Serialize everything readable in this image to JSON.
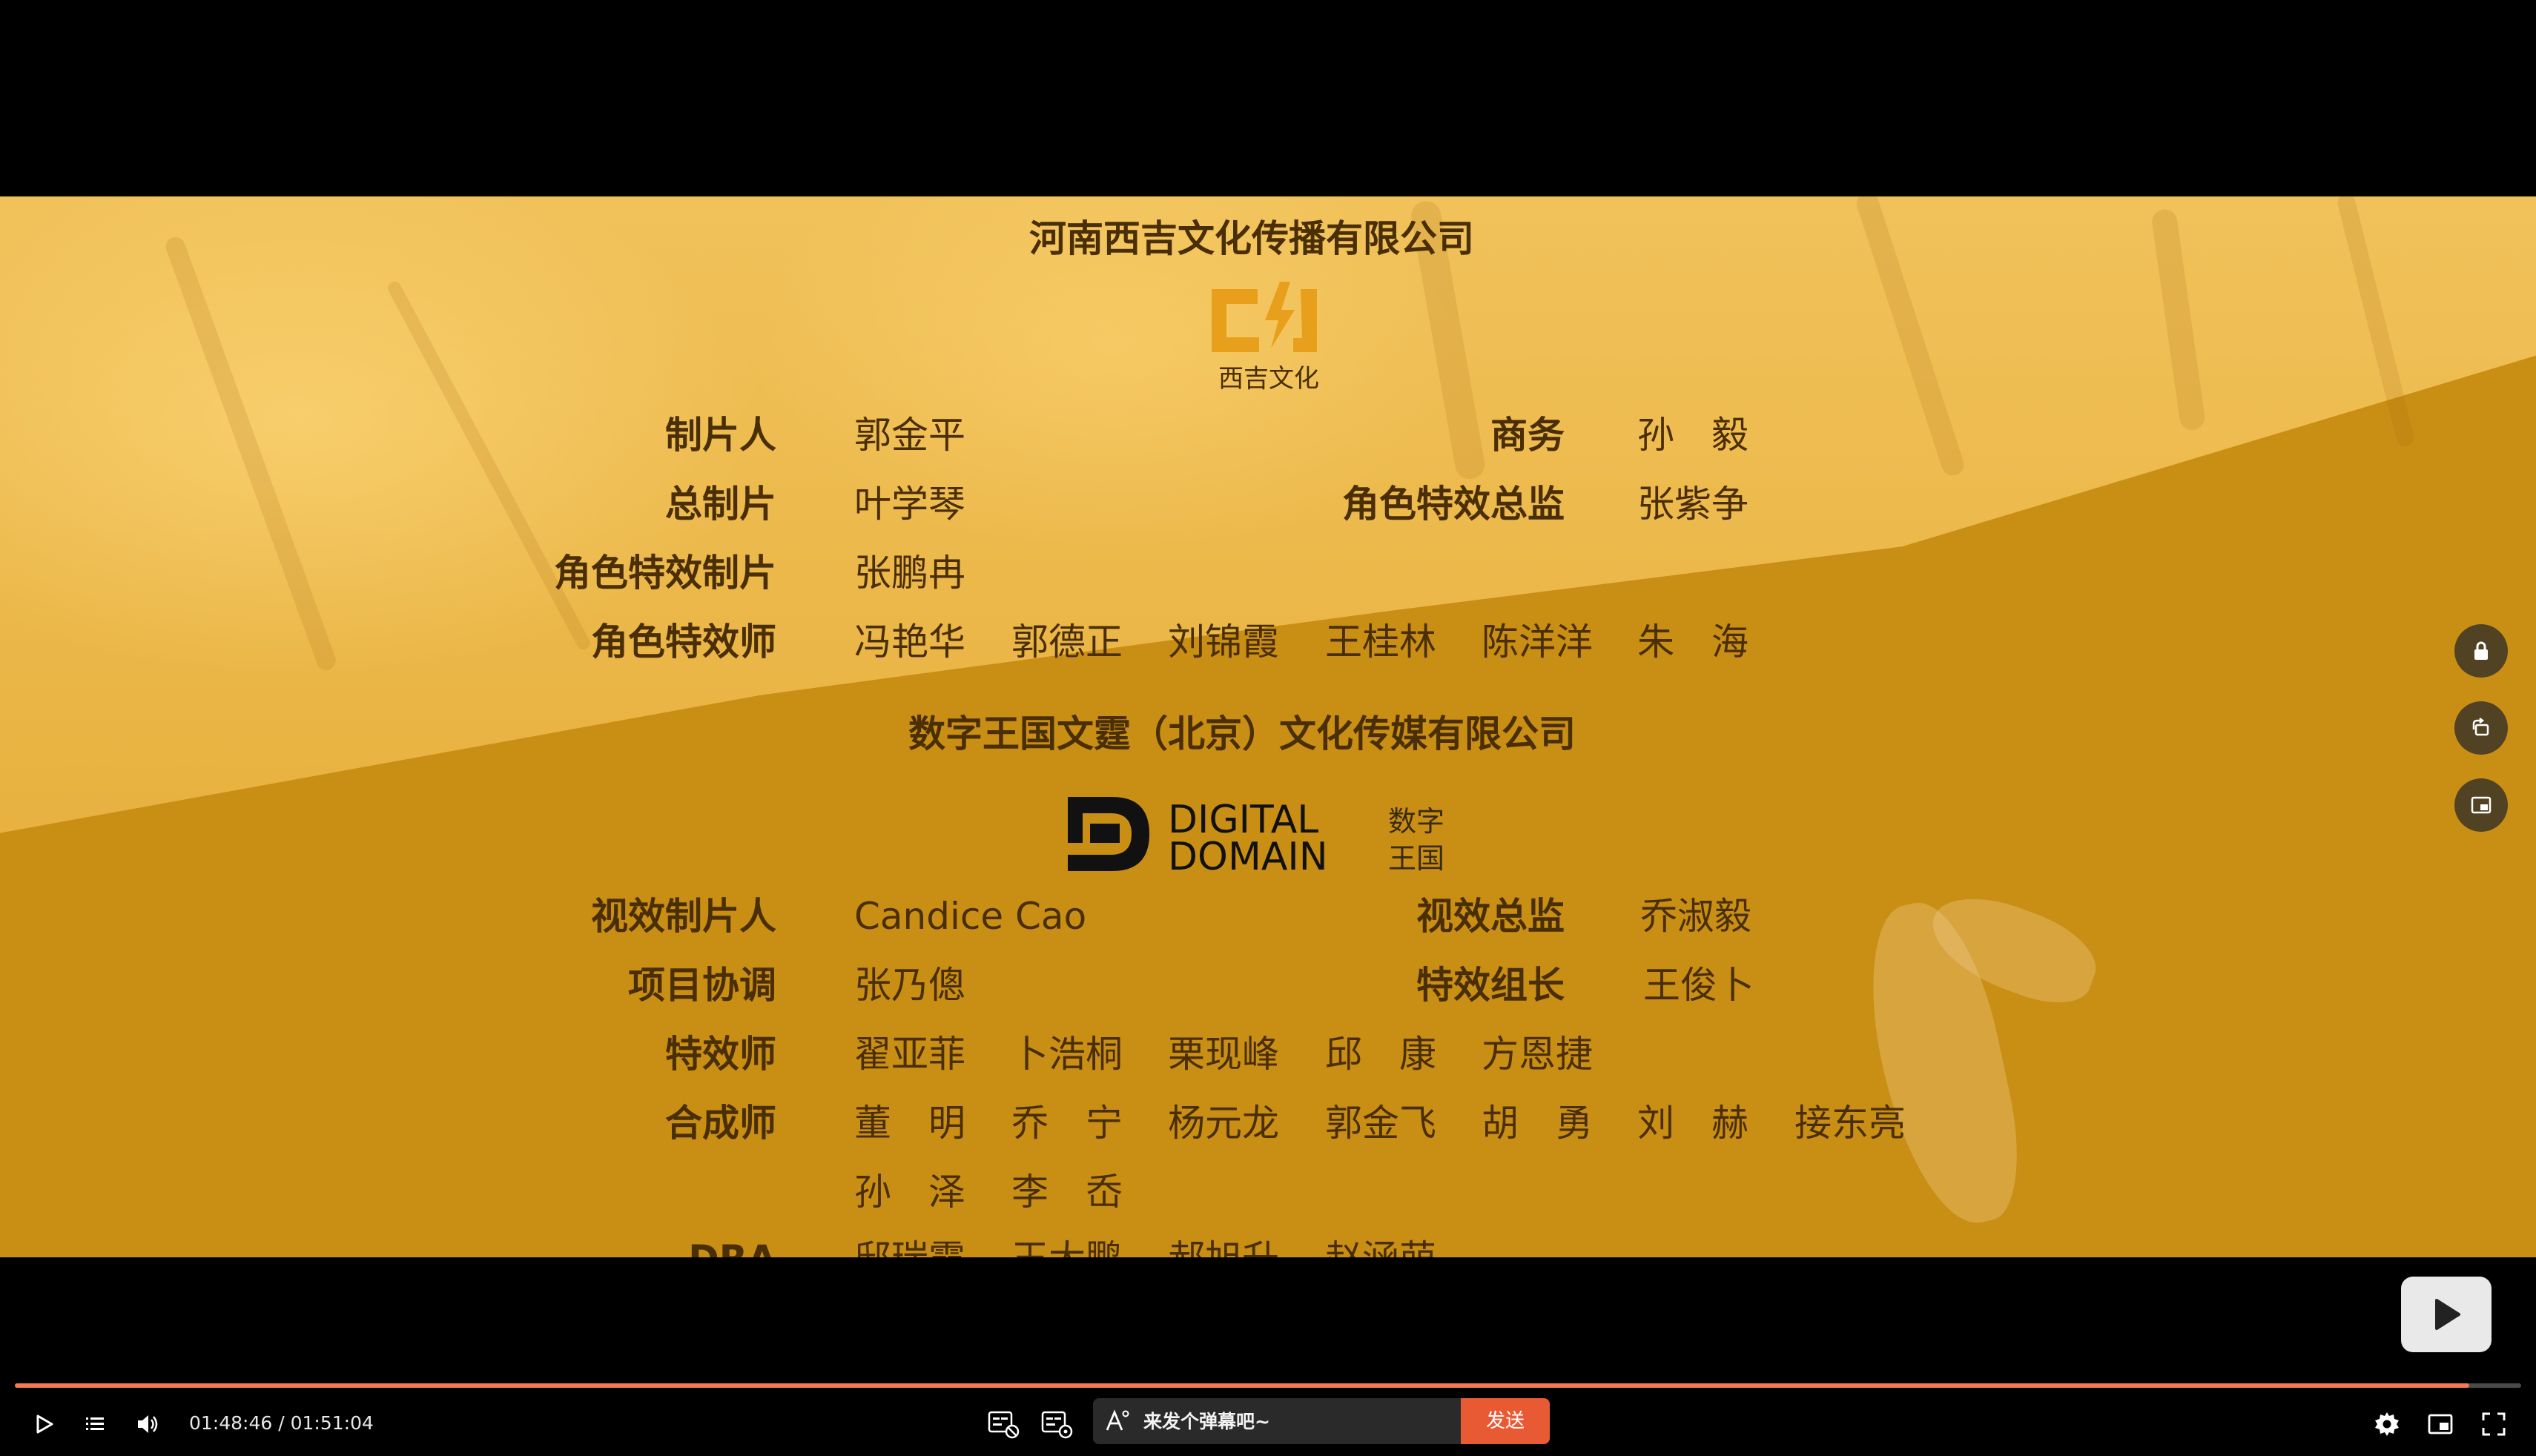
{
  "credits": {
    "company1": "河南西吉文化传播有限公司",
    "company1_logo_text": "西吉文化",
    "rows1": [
      {
        "role": "制片人",
        "names": [
          "郭金平"
        ],
        "role2": "商务",
        "names2": [
          "孙　毅"
        ]
      },
      {
        "role": "总制片",
        "names": [
          "叶学琴"
        ],
        "role2": "角色特效总监",
        "names2": [
          "张紫争"
        ]
      },
      {
        "role": "角色特效制片",
        "names": [
          "张鹏冉"
        ]
      },
      {
        "role": "角色特效师",
        "names": [
          "冯艳华",
          "郭德正",
          "刘锦霞",
          "王桂林",
          "陈洋洋",
          "朱　海"
        ]
      }
    ],
    "company2": "数字王国文霆（北京）文化传媒有限公司",
    "company2_logo": {
      "line1": "DIGITAL",
      "line2": "DOMAIN",
      "cn1": "数字",
      "cn2": "王国"
    },
    "rows2": [
      {
        "role": "视效制片人",
        "names": [
          "Candice Cao"
        ],
        "role2": "视效总监",
        "names2": [
          "乔淑毅"
        ]
      },
      {
        "role": "项目协调",
        "names": [
          "张乃傯"
        ],
        "role2": "特效组长",
        "names2": [
          "王俊卜"
        ]
      },
      {
        "role": "特效师",
        "names": [
          "翟亚菲",
          "卜浩桐",
          "栗现峰",
          "邱　康",
          "方恩捷"
        ]
      },
      {
        "role": "合成师",
        "names": [
          "董　明",
          "乔　宁",
          "杨元龙",
          "郭金飞",
          "胡　勇",
          "刘　赫",
          "接东亮"
        ]
      },
      {
        "role": "",
        "names": [
          "孙　泽",
          "李　岙"
        ]
      },
      {
        "role": "DRA",
        "names": [
          "邸瑞霞",
          "王大鹏",
          "郝旭升",
          "赵涵萌"
        ]
      }
    ]
  },
  "player": {
    "time_display": "01:48:46 / 01:51:04",
    "progress_fraction": 0.9793,
    "danmaku_placeholder": "来发个弹幕吧~",
    "send_label": "发送",
    "accent_color": "#f57a4f",
    "send_color": "#e75a34"
  },
  "icons": {
    "side": [
      "lock-icon",
      "rotate-icon",
      "picture-in-picture-icon"
    ],
    "controls_left": [
      "play-icon",
      "playlist-icon",
      "volume-icon"
    ],
    "controls_mid": [
      "danmaku-toggle-icon",
      "danmaku-settings-icon",
      "danmaku-style-icon"
    ],
    "controls_right": [
      "settings-icon",
      "mini-player-icon",
      "fullscreen-icon"
    ]
  }
}
